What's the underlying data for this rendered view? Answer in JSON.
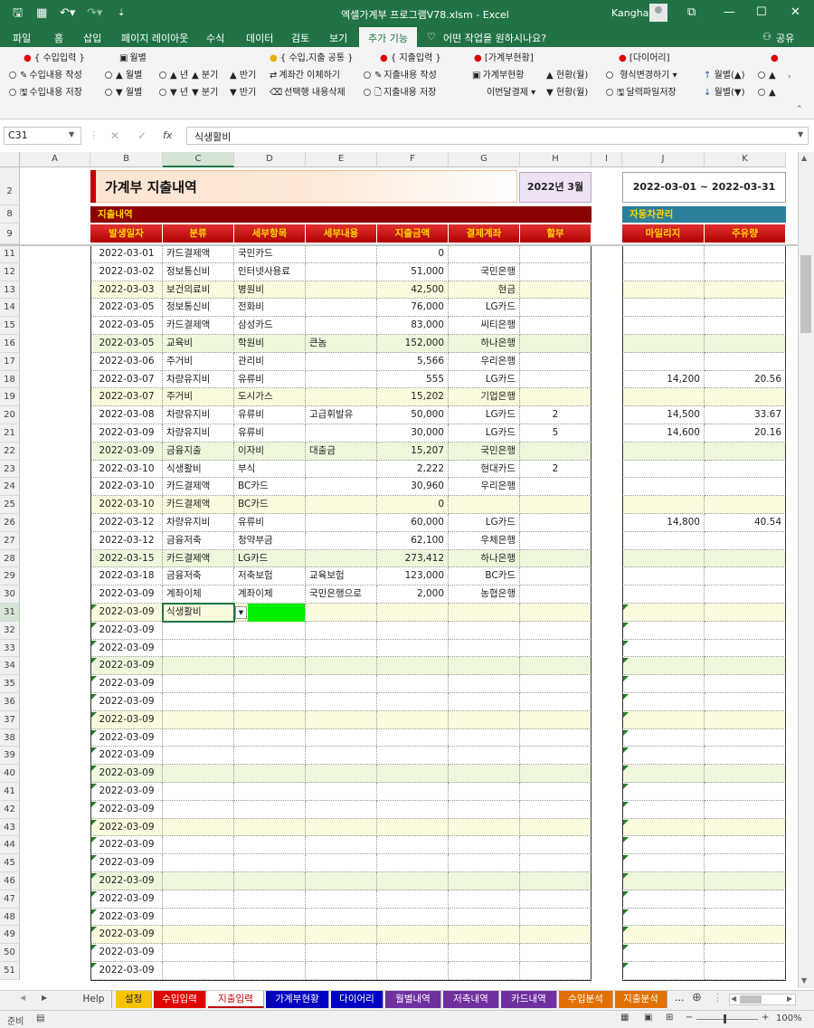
{
  "app": {
    "doc_title": "엑셀가계부 프로그램V78.xlsm  -  Excel",
    "user": "Kangha"
  },
  "ribbon_tabs": [
    "파일",
    "홈",
    "삽입",
    "페이지 레이아웃",
    "수식",
    "데이터",
    "검토",
    "보기",
    "추가 기능"
  ],
  "help_search": "어떤 작업을 원하시나요?",
  "share_label": "공유",
  "ribbon": {
    "income_group": "{ 수입입력 }",
    "income_write": "수입내용 작성",
    "income_save": "수입내용 저장",
    "monthly": "월별",
    "year": "년",
    "quarter": "분기",
    "half": "반기",
    "common_group": "{ 수입,지출 공통 }",
    "transfer": "계좌간 이체하기",
    "delete_row": "선택행 내용삭제",
    "expense_group": "{ 지출입력 }",
    "expense_write": "지출내용 작성",
    "expense_save": "지출내용 저장",
    "status_group": "[가계부현황]",
    "status": "가계부현황",
    "status_month": "현황(월)",
    "next_pay": "이번달결제",
    "diary_group": "[다이어리]",
    "change_form": "형식변경하기",
    "diary_save": "달력파일저장",
    "month_up": "월별(▲)",
    "month_down": "월별(▼)"
  },
  "namebox": "C31",
  "formula": "식생활비",
  "columns": [
    "A",
    "B",
    "C",
    "D",
    "E",
    "F",
    "G",
    "H",
    "I",
    "J",
    "K"
  ],
  "sheet": {
    "title": "가계부 지출내역",
    "month": "2022년 3월",
    "period": "2022-03-01 ~ 2022-03-31",
    "section_main": "지출내역",
    "section_car": "자동차관리",
    "headers": [
      "발생일자",
      "분류",
      "세부항목",
      "세부내용",
      "지출금액",
      "결제계좌",
      "할부"
    ],
    "car_headers": [
      "마일리지",
      "주유량"
    ]
  },
  "rows": [
    {
      "r": "11",
      "date": "2022-03-01",
      "cat": "카드결제액",
      "item": "국민카드",
      "detail": "",
      "amount": "0",
      "acct": "",
      "inst": "",
      "mile": "",
      "fuel": ""
    },
    {
      "r": "12",
      "date": "2022-03-02",
      "cat": "정보통신비",
      "item": "인터넷사용료",
      "detail": "",
      "amount": "51,000",
      "acct": "국민은행",
      "inst": "",
      "mile": "",
      "fuel": ""
    },
    {
      "r": "13",
      "date": "2022-03-03",
      "cat": "보건의료비",
      "item": "병원비",
      "detail": "",
      "amount": "42,500",
      "acct": "현금",
      "inst": "",
      "mile": "",
      "fuel": ""
    },
    {
      "r": "14",
      "date": "2022-03-05",
      "cat": "정보통신비",
      "item": "전화비",
      "detail": "",
      "amount": "76,000",
      "acct": "LG카드",
      "inst": "",
      "mile": "",
      "fuel": ""
    },
    {
      "r": "15",
      "date": "2022-03-05",
      "cat": "카드결제액",
      "item": "삼성카드",
      "detail": "",
      "amount": "83,000",
      "acct": "씨티은행",
      "inst": "",
      "mile": "",
      "fuel": ""
    },
    {
      "r": "16",
      "date": "2022-03-05",
      "cat": "교육비",
      "item": "학원비",
      "detail": "큰놈",
      "amount": "152,000",
      "acct": "하나은행",
      "inst": "",
      "mile": "",
      "fuel": ""
    },
    {
      "r": "17",
      "date": "2022-03-06",
      "cat": "주거비",
      "item": "관리비",
      "detail": "",
      "amount": "5,566",
      "acct": "우리은행",
      "inst": "",
      "mile": "",
      "fuel": ""
    },
    {
      "r": "18",
      "date": "2022-03-07",
      "cat": "차량유지비",
      "item": "유류비",
      "detail": "",
      "amount": "555",
      "acct": "LG카드",
      "inst": "",
      "mile": "14,200",
      "fuel": "20.56"
    },
    {
      "r": "19",
      "date": "2022-03-07",
      "cat": "주거비",
      "item": "도시가스",
      "detail": "",
      "amount": "15,202",
      "acct": "기업은행",
      "inst": "",
      "mile": "",
      "fuel": ""
    },
    {
      "r": "20",
      "date": "2022-03-08",
      "cat": "차량유지비",
      "item": "유류비",
      "detail": "고급휘발유",
      "amount": "50,000",
      "acct": "LG카드",
      "inst": "2",
      "mile": "14,500",
      "fuel": "33.67"
    },
    {
      "r": "21",
      "date": "2022-03-09",
      "cat": "차량유지비",
      "item": "유류비",
      "detail": "",
      "amount": "30,000",
      "acct": "LG카드",
      "inst": "5",
      "mile": "14,600",
      "fuel": "20.16"
    },
    {
      "r": "22",
      "date": "2022-03-09",
      "cat": "금융지출",
      "item": "이자비",
      "detail": "대출금",
      "amount": "15,207",
      "acct": "국민은행",
      "inst": "",
      "mile": "",
      "fuel": ""
    },
    {
      "r": "23",
      "date": "2022-03-10",
      "cat": "식생활비",
      "item": "부식",
      "detail": "",
      "amount": "2,222",
      "acct": "현대카드",
      "inst": "2",
      "mile": "",
      "fuel": ""
    },
    {
      "r": "24",
      "date": "2022-03-10",
      "cat": "카드결제액",
      "item": "BC카드",
      "detail": "",
      "amount": "30,960",
      "acct": "우리은행",
      "inst": "",
      "mile": "",
      "fuel": ""
    },
    {
      "r": "25",
      "date": "2022-03-10",
      "cat": "카드결제액",
      "item": "BC카드",
      "detail": "",
      "amount": "0",
      "acct": "",
      "inst": "",
      "mile": "",
      "fuel": ""
    },
    {
      "r": "26",
      "date": "2022-03-12",
      "cat": "차량유지비",
      "item": "유류비",
      "detail": "",
      "amount": "60,000",
      "acct": "LG카드",
      "inst": "",
      "mile": "14,800",
      "fuel": "40.54"
    },
    {
      "r": "27",
      "date": "2022-03-12",
      "cat": "금융저축",
      "item": "청약부금",
      "detail": "",
      "amount": "62,100",
      "acct": "우체은행",
      "inst": "",
      "mile": "",
      "fuel": ""
    },
    {
      "r": "28",
      "date": "2022-03-15",
      "cat": "카드결제액",
      "item": "LG카드",
      "detail": "",
      "amount": "273,412",
      "acct": "하나은행",
      "inst": "",
      "mile": "",
      "fuel": ""
    },
    {
      "r": "29",
      "date": "2022-03-18",
      "cat": "금융저축",
      "item": "저축보험",
      "detail": "교육보험",
      "amount": "123,000",
      "acct": "BC카드",
      "inst": "",
      "mile": "",
      "fuel": ""
    },
    {
      "r": "30",
      "date": "2022-03-09",
      "cat": "계좌이체",
      "item": "계좌이체",
      "detail": "국민은행으로",
      "amount": "2,000",
      "acct": "농협은행",
      "inst": "",
      "mile": "",
      "fuel": ""
    },
    {
      "r": "31",
      "date": "2022-03-09",
      "cat": "식생활비",
      "item": "",
      "detail": "",
      "amount": "",
      "acct": "",
      "inst": "",
      "mile": "",
      "fuel": ""
    },
    {
      "r": "32",
      "date": "2022-03-09",
      "cat": "",
      "item": "",
      "detail": "",
      "amount": "",
      "acct": "",
      "inst": "",
      "mile": "",
      "fuel": ""
    },
    {
      "r": "33",
      "date": "2022-03-09",
      "cat": "",
      "item": "",
      "detail": "",
      "amount": "",
      "acct": "",
      "inst": "",
      "mile": "",
      "fuel": ""
    },
    {
      "r": "34",
      "date": "2022-03-09",
      "cat": "",
      "item": "",
      "detail": "",
      "amount": "",
      "acct": "",
      "inst": "",
      "mile": "",
      "fuel": ""
    },
    {
      "r": "35",
      "date": "2022-03-09",
      "cat": "",
      "item": "",
      "detail": "",
      "amount": "",
      "acct": "",
      "inst": "",
      "mile": "",
      "fuel": ""
    },
    {
      "r": "36",
      "date": "2022-03-09",
      "cat": "",
      "item": "",
      "detail": "",
      "amount": "",
      "acct": "",
      "inst": "",
      "mile": "",
      "fuel": ""
    },
    {
      "r": "37",
      "date": "2022-03-09",
      "cat": "",
      "item": "",
      "detail": "",
      "amount": "",
      "acct": "",
      "inst": "",
      "mile": "",
      "fuel": ""
    },
    {
      "r": "38",
      "date": "2022-03-09",
      "cat": "",
      "item": "",
      "detail": "",
      "amount": "",
      "acct": "",
      "inst": "",
      "mile": "",
      "fuel": ""
    },
    {
      "r": "39",
      "date": "2022-03-09",
      "cat": "",
      "item": "",
      "detail": "",
      "amount": "",
      "acct": "",
      "inst": "",
      "mile": "",
      "fuel": ""
    },
    {
      "r": "40",
      "date": "2022-03-09",
      "cat": "",
      "item": "",
      "detail": "",
      "amount": "",
      "acct": "",
      "inst": "",
      "mile": "",
      "fuel": ""
    },
    {
      "r": "41",
      "date": "2022-03-09",
      "cat": "",
      "item": "",
      "detail": "",
      "amount": "",
      "acct": "",
      "inst": "",
      "mile": "",
      "fuel": ""
    },
    {
      "r": "42",
      "date": "2022-03-09",
      "cat": "",
      "item": "",
      "detail": "",
      "amount": "",
      "acct": "",
      "inst": "",
      "mile": "",
      "fuel": ""
    },
    {
      "r": "43",
      "date": "2022-03-09",
      "cat": "",
      "item": "",
      "detail": "",
      "amount": "",
      "acct": "",
      "inst": "",
      "mile": "",
      "fuel": ""
    },
    {
      "r": "44",
      "date": "2022-03-09",
      "cat": "",
      "item": "",
      "detail": "",
      "amount": "",
      "acct": "",
      "inst": "",
      "mile": "",
      "fuel": ""
    },
    {
      "r": "45",
      "date": "2022-03-09",
      "cat": "",
      "item": "",
      "detail": "",
      "amount": "",
      "acct": "",
      "inst": "",
      "mile": "",
      "fuel": ""
    },
    {
      "r": "46",
      "date": "2022-03-09",
      "cat": "",
      "item": "",
      "detail": "",
      "amount": "",
      "acct": "",
      "inst": "",
      "mile": "",
      "fuel": ""
    },
    {
      "r": "47",
      "date": "2022-03-09",
      "cat": "",
      "item": "",
      "detail": "",
      "amount": "",
      "acct": "",
      "inst": "",
      "mile": "",
      "fuel": ""
    },
    {
      "r": "48",
      "date": "2022-03-09",
      "cat": "",
      "item": "",
      "detail": "",
      "amount": "",
      "acct": "",
      "inst": "",
      "mile": "",
      "fuel": ""
    },
    {
      "r": "49",
      "date": "2022-03-09",
      "cat": "",
      "item": "",
      "detail": "",
      "amount": "",
      "acct": "",
      "inst": "",
      "mile": "",
      "fuel": ""
    },
    {
      "r": "50",
      "date": "2022-03-09",
      "cat": "",
      "item": "",
      "detail": "",
      "amount": "",
      "acct": "",
      "inst": "",
      "mile": "",
      "fuel": ""
    },
    {
      "r": "51",
      "date": "2022-03-09",
      "cat": "",
      "item": "",
      "detail": "",
      "amount": "",
      "acct": "",
      "inst": "",
      "mile": "",
      "fuel": ""
    }
  ],
  "sheet_tabs": [
    {
      "label": "Help",
      "color": "#f0f0f0",
      "text": "#333"
    },
    {
      "label": "설정",
      "color": "#f5c400",
      "text": "#222"
    },
    {
      "label": "수입입력",
      "color": "#e00000",
      "text": "#fff"
    },
    {
      "label": "지출입력",
      "color": "#ffffff",
      "text": "#c00000"
    },
    {
      "label": "가계부현황",
      "color": "#0000c0",
      "text": "#fff"
    },
    {
      "label": "다이어리",
      "color": "#0000c0",
      "text": "#fff"
    },
    {
      "label": "월별내역",
      "color": "#7030a0",
      "text": "#fff"
    },
    {
      "label": "저축내역",
      "color": "#7030a0",
      "text": "#fff"
    },
    {
      "label": "카드내역",
      "color": "#7030a0",
      "text": "#fff"
    },
    {
      "label": "수입분석",
      "color": "#e07000",
      "text": "#fff"
    },
    {
      "label": "지출분석",
      "color": "#e07000",
      "text": "#fff"
    }
  ],
  "tab_more": "...",
  "status": {
    "ready": "준비",
    "zoom": "100%"
  }
}
